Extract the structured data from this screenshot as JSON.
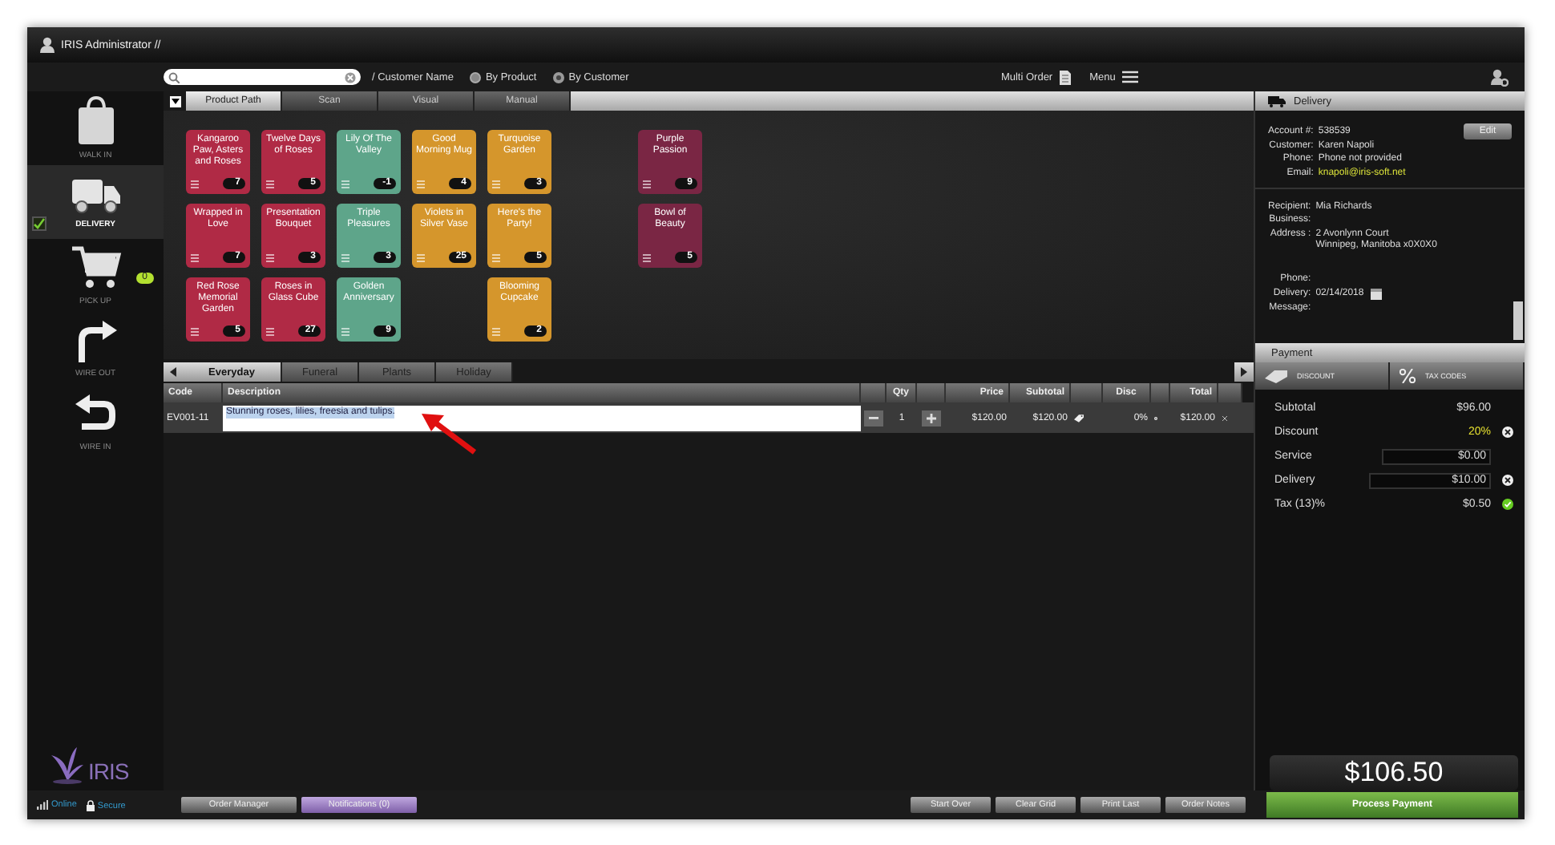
{
  "window": {
    "title": "IRIS Administrator //"
  },
  "toolbar": {
    "search_label": "/ Customer Name",
    "radios": [
      {
        "label": "By Product",
        "selected": false
      },
      {
        "label": "By Customer",
        "selected": true
      }
    ],
    "multi_order": "Multi Order",
    "menu": "Menu"
  },
  "sidebar": {
    "items": [
      {
        "label": "WALK IN",
        "kind": "bag",
        "selected": false,
        "checked": false
      },
      {
        "label": "DELIVERY",
        "kind": "truck",
        "selected": true,
        "checked": true
      },
      {
        "label": "PICK UP",
        "kind": "cart",
        "selected": false,
        "checked": false,
        "badge": "0"
      },
      {
        "label": "WIRE OUT",
        "kind": "wire-out",
        "selected": false,
        "checked": false
      },
      {
        "label": "WIRE IN",
        "kind": "wire-in",
        "selected": false,
        "checked": false
      }
    ],
    "logo": "IRIS"
  },
  "product_tabs": [
    {
      "label": "Product Path",
      "selected": true
    },
    {
      "label": "Scan",
      "selected": false
    },
    {
      "label": "Visual",
      "selected": false
    },
    {
      "label": "Manual",
      "selected": false
    }
  ],
  "tile_rows": [
    [
      {
        "name": "Kangaroo Paw, Asters and Roses",
        "count": "7",
        "color": "#b02a45"
      },
      {
        "name": "Twelve Days of Roses",
        "count": "5",
        "color": "#b02a45"
      },
      {
        "name": "Lily Of The Valley",
        "count": "-1",
        "color": "#5ea58a"
      },
      {
        "name": "Good Morning Mug",
        "count": "4",
        "color": "#d5962c"
      },
      {
        "name": "Turquoise Garden",
        "count": "3",
        "color": "#d5962c"
      },
      null,
      {
        "name": "Purple Passion",
        "count": "9",
        "color": "#7a2644"
      }
    ],
    [
      {
        "name": "Wrapped in Love",
        "count": "7",
        "color": "#b02a45"
      },
      {
        "name": "Presentation Bouquet",
        "count": "3",
        "color": "#b02a45"
      },
      {
        "name": "Triple Pleasures",
        "count": "3",
        "color": "#5ea58a"
      },
      {
        "name": "Violets in Silver Vase",
        "count": "25",
        "color": "#d5962c"
      },
      {
        "name": "Here's the Party!",
        "count": "5",
        "color": "#d5962c"
      },
      null,
      {
        "name": "Bowl of Beauty",
        "count": "5",
        "color": "#7a2644"
      }
    ],
    [
      {
        "name": "Red Rose Memorial Garden",
        "count": "5",
        "color": "#b02a45"
      },
      {
        "name": "Roses in Glass Cube",
        "count": "27",
        "color": "#b02a45"
      },
      {
        "name": "Golden Anniversary",
        "count": "9",
        "color": "#5ea58a"
      },
      null,
      {
        "name": "Blooming Cupcake",
        "count": "2",
        "color": "#d5962c"
      }
    ]
  ],
  "category_tabs": [
    {
      "label": "Everyday",
      "selected": true
    },
    {
      "label": "Funeral",
      "selected": false
    },
    {
      "label": "Plants",
      "selected": false
    },
    {
      "label": "Holiday",
      "selected": false
    }
  ],
  "order_table": {
    "columns": [
      "Code",
      "Description",
      "Qty",
      "Price",
      "Subtotal",
      "Disc",
      "Total"
    ],
    "rows": [
      {
        "code": "EV001-11",
        "description": "Stunning roses, lilies, freesia and tulips.",
        "qty": "1",
        "price": "$120.00",
        "subtotal": "$120.00",
        "disc": "0%",
        "total": "$120.00"
      }
    ]
  },
  "delivery_panel": {
    "title": "Delivery",
    "edit": "Edit",
    "customer_fields": [
      {
        "label": "Account #:",
        "value": "538539",
        "kind": "plain"
      },
      {
        "label": "Customer:",
        "value": "Karen Napoli",
        "kind": "plain"
      },
      {
        "label": "Phone:",
        "value": "Phone not provided",
        "kind": "plain"
      },
      {
        "label": "Email:",
        "value": "knapoli@iris-soft.net",
        "kind": "link"
      }
    ],
    "recipient_fields": [
      {
        "label": "Recipient:",
        "lines": [
          "Mia Richards"
        ]
      },
      {
        "label": "Business:"
      },
      {
        "label": "Address :",
        "lines": [
          "2 Avonlynn Court",
          "Winnipeg, Manitoba x0X0X0"
        ]
      }
    ],
    "delivery_fields": [
      {
        "label": "Phone:"
      },
      {
        "label": "Delivery:",
        "lines": [
          "02/14/2018"
        ],
        "kind": "date"
      },
      {
        "label": "Message:"
      }
    ]
  },
  "payment": {
    "title": "Payment",
    "buttons": [
      {
        "label": "DISCOUNT",
        "kind": "tag"
      },
      {
        "label": "TAX CODES",
        "kind": "percent"
      }
    ],
    "rows": [
      {
        "label": "Subtotal",
        "value": "$96.00",
        "kind": "plain",
        "removable": false,
        "confirmed": false
      },
      {
        "label": "Discount",
        "value": "20%",
        "kind": "highlight",
        "removable": true,
        "confirmed": false
      },
      {
        "label": "Service",
        "value": "$0.00",
        "kind": "field",
        "removable": false,
        "confirmed": false
      },
      {
        "label": "Delivery",
        "value": "$10.00",
        "kind": "field",
        "removable": true,
        "confirmed": false
      },
      {
        "label": "Tax (13)%",
        "value": "$0.50",
        "kind": "plain",
        "removable": false,
        "confirmed": true
      }
    ],
    "total": "$106.50",
    "process": "Process Payment"
  },
  "status": {
    "online": "Online",
    "secure": "Secure"
  },
  "bottom_buttons": [
    {
      "label": "Order Manager",
      "kind": "plain"
    },
    {
      "label": "Notifications (0)",
      "kind": "highlight"
    }
  ],
  "action_buttons": [
    "Start Over",
    "Clear Grid",
    "Print Last",
    "Order Notes"
  ]
}
